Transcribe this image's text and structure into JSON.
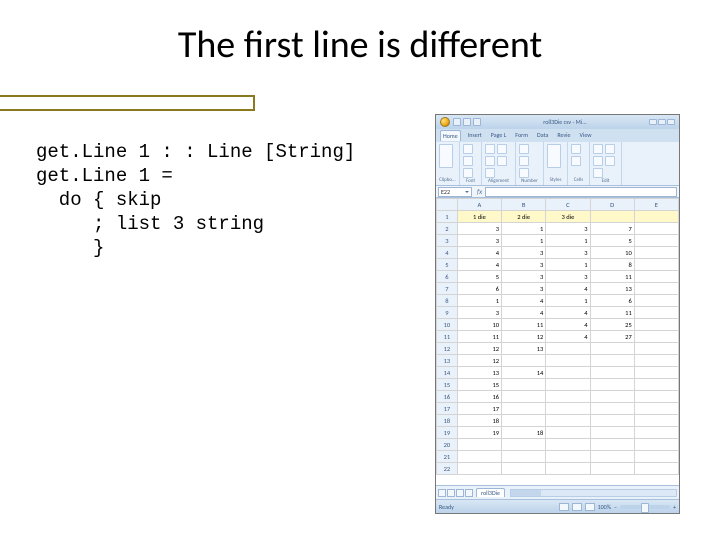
{
  "slide": {
    "title": "The first line is different",
    "code": "get.Line 1 : : Line [String]\nget.Line 1 =\n  do { skip\n     ; list 3 string\n     }"
  },
  "excel": {
    "window_title": "roll3Die csv - Mi...",
    "namebox": "E22",
    "ribbon": {
      "tabs": [
        "Home",
        "Insert",
        "Page L",
        "Form",
        "Data",
        "Revie",
        "View"
      ],
      "active_tab": "Home",
      "groups": [
        "Clipbo...",
        "Font",
        "Alignment",
        "Number",
        "Styles",
        "Cells",
        "Edit"
      ]
    },
    "columns": [
      "A",
      "B",
      "C",
      "D",
      "E"
    ],
    "rows": [
      {
        "n": "1",
        "cells": [
          "1 die",
          "2 die",
          "3 die",
          "",
          ""
        ],
        "header_like": true
      },
      {
        "n": "2",
        "cells": [
          "3",
          "1",
          "3",
          "7",
          ""
        ]
      },
      {
        "n": "3",
        "cells": [
          "3",
          "1",
          "1",
          "5",
          ""
        ]
      },
      {
        "n": "4",
        "cells": [
          "4",
          "3",
          "3",
          "10",
          ""
        ]
      },
      {
        "n": "5",
        "cells": [
          "4",
          "3",
          "1",
          "8",
          ""
        ]
      },
      {
        "n": "6",
        "cells": [
          "5",
          "3",
          "3",
          "11",
          ""
        ]
      },
      {
        "n": "7",
        "cells": [
          "6",
          "3",
          "4",
          "13",
          ""
        ]
      },
      {
        "n": "8",
        "cells": [
          "1",
          "4",
          "1",
          "6",
          ""
        ]
      },
      {
        "n": "9",
        "cells": [
          "3",
          "4",
          "4",
          "11",
          ""
        ]
      },
      {
        "n": "10",
        "cells": [
          "10",
          "11",
          "4",
          "25",
          ""
        ]
      },
      {
        "n": "11",
        "cells": [
          "11",
          "12",
          "4",
          "27",
          ""
        ]
      },
      {
        "n": "12",
        "cells": [
          "12",
          "13",
          "",
          "",
          ""
        ]
      },
      {
        "n": "13",
        "cells": [
          "12",
          "",
          "",
          "",
          ""
        ]
      },
      {
        "n": "14",
        "cells": [
          "13",
          "14",
          "",
          "",
          ""
        ]
      },
      {
        "n": "15",
        "cells": [
          "15",
          "",
          "",
          "",
          ""
        ]
      },
      {
        "n": "16",
        "cells": [
          "16",
          "",
          "",
          "",
          ""
        ]
      },
      {
        "n": "17",
        "cells": [
          "17",
          "",
          "",
          "",
          ""
        ]
      },
      {
        "n": "18",
        "cells": [
          "18",
          "",
          "",
          "",
          ""
        ]
      },
      {
        "n": "19",
        "cells": [
          "19",
          "18",
          "",
          "",
          ""
        ]
      },
      {
        "n": "20",
        "cells": [
          "",
          "",
          "",
          "",
          ""
        ]
      },
      {
        "n": "21",
        "cells": [
          "",
          "",
          "",
          "",
          ""
        ]
      },
      {
        "n": "22",
        "cells": [
          "",
          "",
          "",
          "",
          ""
        ]
      }
    ],
    "sheet_tab": "roll3Die",
    "status": {
      "left": "Ready",
      "zoom": "100%"
    }
  }
}
